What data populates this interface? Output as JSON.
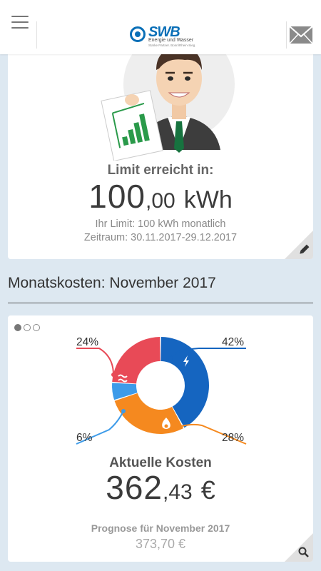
{
  "header": {
    "menu_icon": "hamburger-icon",
    "logo": {
      "brand": "SWB",
      "line1": "Energie und Wasser",
      "line2": "Starke Partner. Bonn/Rhein-Sieg."
    },
    "mail_icon": "envelope-icon"
  },
  "limit_card": {
    "title": "Limit erreicht in:",
    "value_int": "100",
    "value_dec": ",00",
    "unit": "kWh",
    "limit_text": "Ihr Limit: 100 kWh monatlich",
    "period_text": "Zeitraum: 30.11.2017-29.12.2017",
    "edit_icon": "pencil-icon"
  },
  "section": {
    "title": "Monatskosten: November 2017"
  },
  "costs_card": {
    "pager": {
      "total": 3,
      "active": 0
    },
    "chart_data": {
      "type": "pie",
      "donut": true,
      "slices": [
        {
          "label": "Strom",
          "value": 42,
          "display": "42%",
          "color": "#1565c0",
          "icon": "lightning-icon"
        },
        {
          "label": "Gas",
          "value": 28,
          "display": "28%",
          "color": "#f5891f",
          "icon": "flame-icon"
        },
        {
          "label": "Wasser",
          "value": 6,
          "display": "6%",
          "color": "#3d9be9",
          "icon": ""
        },
        {
          "label": "Wärme",
          "value": 24,
          "display": "24%",
          "color": "#e84a57",
          "icon": "heat-icon"
        }
      ]
    },
    "title": "Aktuelle Kosten",
    "value_int": "362",
    "value_dec": ",43",
    "unit": "€",
    "forecast_label": "Prognose für November 2017",
    "forecast_value": "373,70 €",
    "zoom_icon": "magnifier-icon"
  },
  "colors": {
    "background": "#dde8f1",
    "brand_blue": "#0a6fb7",
    "corner_bg": "#e0e0e0"
  }
}
